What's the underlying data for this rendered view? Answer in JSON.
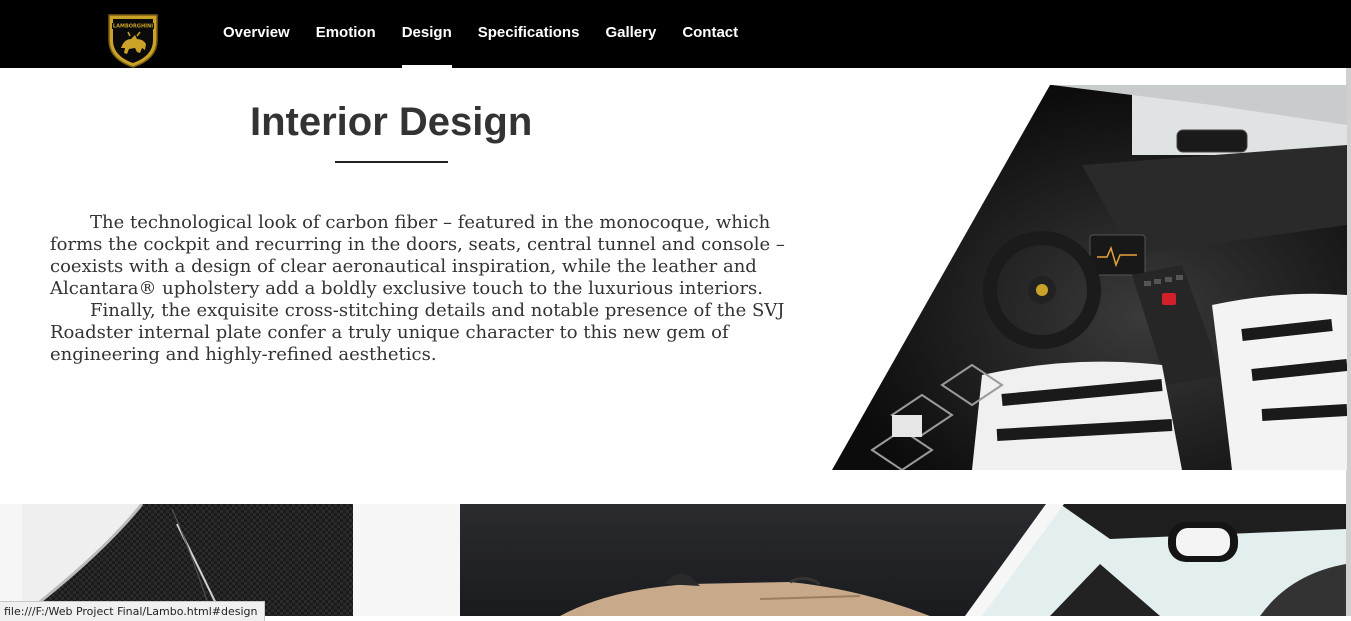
{
  "nav": {
    "logo_text": "LAMBORGHINI",
    "items": [
      {
        "label": "Overview"
      },
      {
        "label": "Emotion"
      },
      {
        "label": "Design",
        "active": true
      },
      {
        "label": "Specifications"
      },
      {
        "label": "Gallery"
      },
      {
        "label": "Contact"
      }
    ]
  },
  "design": {
    "title": "Interior Design",
    "paragraphs": [
      "The technological look of carbon fiber – featured in the monocoque, which forms the cockpit and recurring in the doors, seats, central tunnel and console – coexists with a design of clear aeronautical inspiration, while the leather and Alcantara® upholstery add a boldly exclusive touch to the luxurious interiors.",
      "Finally, the exquisite cross-stitching details and notable presence of the SVJ Roadster internal plate confer a truly unique character to this new gem of engineering and highly-refined aesthetics."
    ]
  },
  "status_bar": {
    "url": "file:///F:/Web Project Final/Lambo.html#design"
  },
  "colors": {
    "nav_bg": "#000000",
    "nav_text": "#ffffff",
    "title_text": "#333333",
    "body_text": "#333333",
    "brand_gold": "#c9a227"
  }
}
